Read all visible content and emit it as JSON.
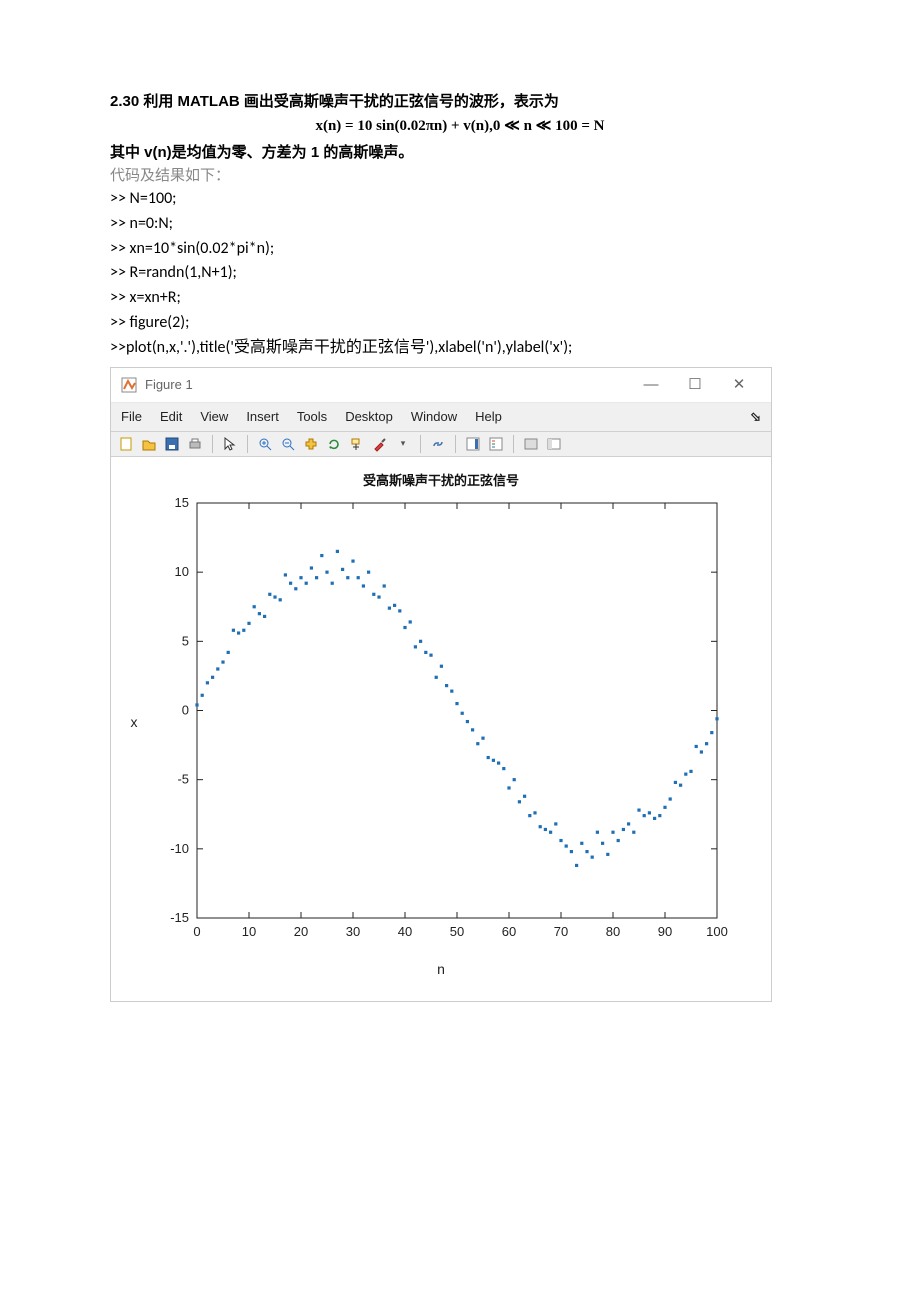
{
  "doc": {
    "heading": "2.30 利用 MATLAB 画出受高斯噪声干扰的正弦信号的波形，表示为",
    "formula": "x(n) = 10 sin(0.02πn) + v(n),0  ≪ n ≪ 100 = N",
    "line2": "其中 v(n)是均值为零、方差为 1 的高斯噪声。",
    "subhead": "代码及结果如下：",
    "code": [
      ">> N=100;",
      ">> n=0:N;",
      ">> xn=10*sin(0.02*pi*n);",
      ">> R=randn(1,N+1);",
      ">> x=xn+R;",
      ">> figure(2);",
      ">>plot(n,x,'.'),title('受高斯噪声干扰的正弦信号'),xlabel('n'),ylabel('x');"
    ]
  },
  "figwin": {
    "title": "Figure 1",
    "menus": [
      "File",
      "Edit",
      "View",
      "Insert",
      "Tools",
      "Desktop",
      "Window",
      "Help"
    ],
    "toolbar_icons": [
      "new-icon",
      "open-icon",
      "save-icon",
      "print-icon",
      "|",
      "pointer-icon",
      "|",
      "zoom-in-icon",
      "zoom-out-icon",
      "pan-icon",
      "rotate-icon",
      "data-cursor-icon",
      "brush-icon",
      "dropdown-icon",
      "|",
      "link-icon",
      "|",
      "colorbar-icon",
      "legend-icon",
      "|",
      "hide-icon",
      "dock-icon"
    ],
    "chart": {
      "title": "受高斯噪声干扰的正弦信号",
      "xlabel": "n",
      "ylabel": "x"
    },
    "winbtns": {
      "min": "—",
      "max": "☐",
      "close": "✕"
    }
  },
  "chart_data": {
    "type": "scatter",
    "title": "受高斯噪声干扰的正弦信号",
    "xlabel": "n",
    "ylabel": "x",
    "xlim": [
      0,
      100
    ],
    "ylim": [
      -15,
      15
    ],
    "xticks": [
      0,
      10,
      20,
      30,
      40,
      50,
      60,
      70,
      80,
      90,
      100
    ],
    "yticks": [
      -15,
      -10,
      -5,
      0,
      5,
      10,
      15
    ],
    "series": [
      {
        "name": "x(n)",
        "color": "#1f6fb5",
        "x": [
          0,
          1,
          2,
          3,
          4,
          5,
          6,
          7,
          8,
          9,
          10,
          11,
          12,
          13,
          14,
          15,
          16,
          17,
          18,
          19,
          20,
          21,
          22,
          23,
          24,
          25,
          26,
          27,
          28,
          29,
          30,
          31,
          32,
          33,
          34,
          35,
          36,
          37,
          38,
          39,
          40,
          41,
          42,
          43,
          44,
          45,
          46,
          47,
          48,
          49,
          50,
          51,
          52,
          53,
          54,
          55,
          56,
          57,
          58,
          59,
          60,
          61,
          62,
          63,
          64,
          65,
          66,
          67,
          68,
          69,
          70,
          71,
          72,
          73,
          74,
          75,
          76,
          77,
          78,
          79,
          80,
          81,
          82,
          83,
          84,
          85,
          86,
          87,
          88,
          89,
          90,
          91,
          92,
          93,
          94,
          95,
          96,
          97,
          98,
          99,
          100
        ],
        "y": [
          0.4,
          1.1,
          2.0,
          2.4,
          3.0,
          3.5,
          4.2,
          5.8,
          5.6,
          5.8,
          6.3,
          7.5,
          7.0,
          6.8,
          8.4,
          8.2,
          8.0,
          9.8,
          9.2,
          8.8,
          9.6,
          9.2,
          10.3,
          9.6,
          11.2,
          10.0,
          9.2,
          11.5,
          10.2,
          9.6,
          10.8,
          9.6,
          9.0,
          10.0,
          8.4,
          8.2,
          9.0,
          7.4,
          7.6,
          7.2,
          6.0,
          6.4,
          4.6,
          5.0,
          4.2,
          4.0,
          2.4,
          3.2,
          1.8,
          1.4,
          0.5,
          -0.2,
          -0.8,
          -1.4,
          -2.4,
          -2.0,
          -3.4,
          -3.6,
          -3.8,
          -4.2,
          -5.6,
          -5.0,
          -6.6,
          -6.2,
          -7.6,
          -7.4,
          -8.4,
          -8.6,
          -8.8,
          -8.2,
          -9.4,
          -9.8,
          -10.2,
          -11.2,
          -9.6,
          -10.2,
          -10.6,
          -8.8,
          -9.6,
          -10.4,
          -8.8,
          -9.4,
          -8.6,
          -8.2,
          -8.8,
          -7.2,
          -7.6,
          -7.4,
          -7.8,
          -7.6,
          -7.0,
          -6.4,
          -5.2,
          -5.4,
          -4.6,
          -4.4,
          -2.6,
          -3.0,
          -2.4,
          -1.6,
          -0.6
        ]
      }
    ]
  }
}
